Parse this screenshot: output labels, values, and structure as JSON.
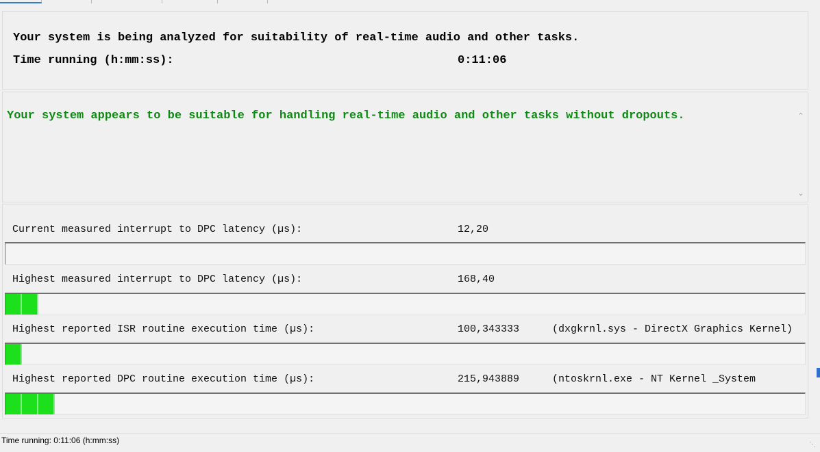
{
  "header": {
    "analyzing_text": "Your system is being analyzed for suitability of real-time audio and other tasks.",
    "time_label": "Time running (h:mm:ss):",
    "time_value": "0:11:06"
  },
  "result": {
    "message": "Your system appears to be suitable for handling real-time audio and other tasks without dropouts."
  },
  "metrics": [
    {
      "label": "Current measured interrupt to DPC latency (µs):",
      "value": "12,20",
      "detail": "",
      "level_segments": 0
    },
    {
      "label": "Highest measured interrupt to DPC latency (µs):",
      "value": "168,40",
      "detail": "",
      "level_segments": 2
    },
    {
      "label": "Highest reported ISR routine execution time (µs):",
      "value": "100,343333",
      "detail": "(dxgkrnl.sys - DirectX Graphics Kernel)",
      "level_segments": 1
    },
    {
      "label": "Highest reported DPC routine execution time (µs):",
      "value": "215,943889",
      "detail": "(ntoskrnl.exe - NT Kernel _System",
      "level_segments": 3
    }
  ],
  "statusbar": {
    "text": "Time running: 0:11:06  (h:mm:ss)"
  },
  "colors": {
    "good_text": "#0f8a14",
    "bar_fill": "#1de01d"
  }
}
